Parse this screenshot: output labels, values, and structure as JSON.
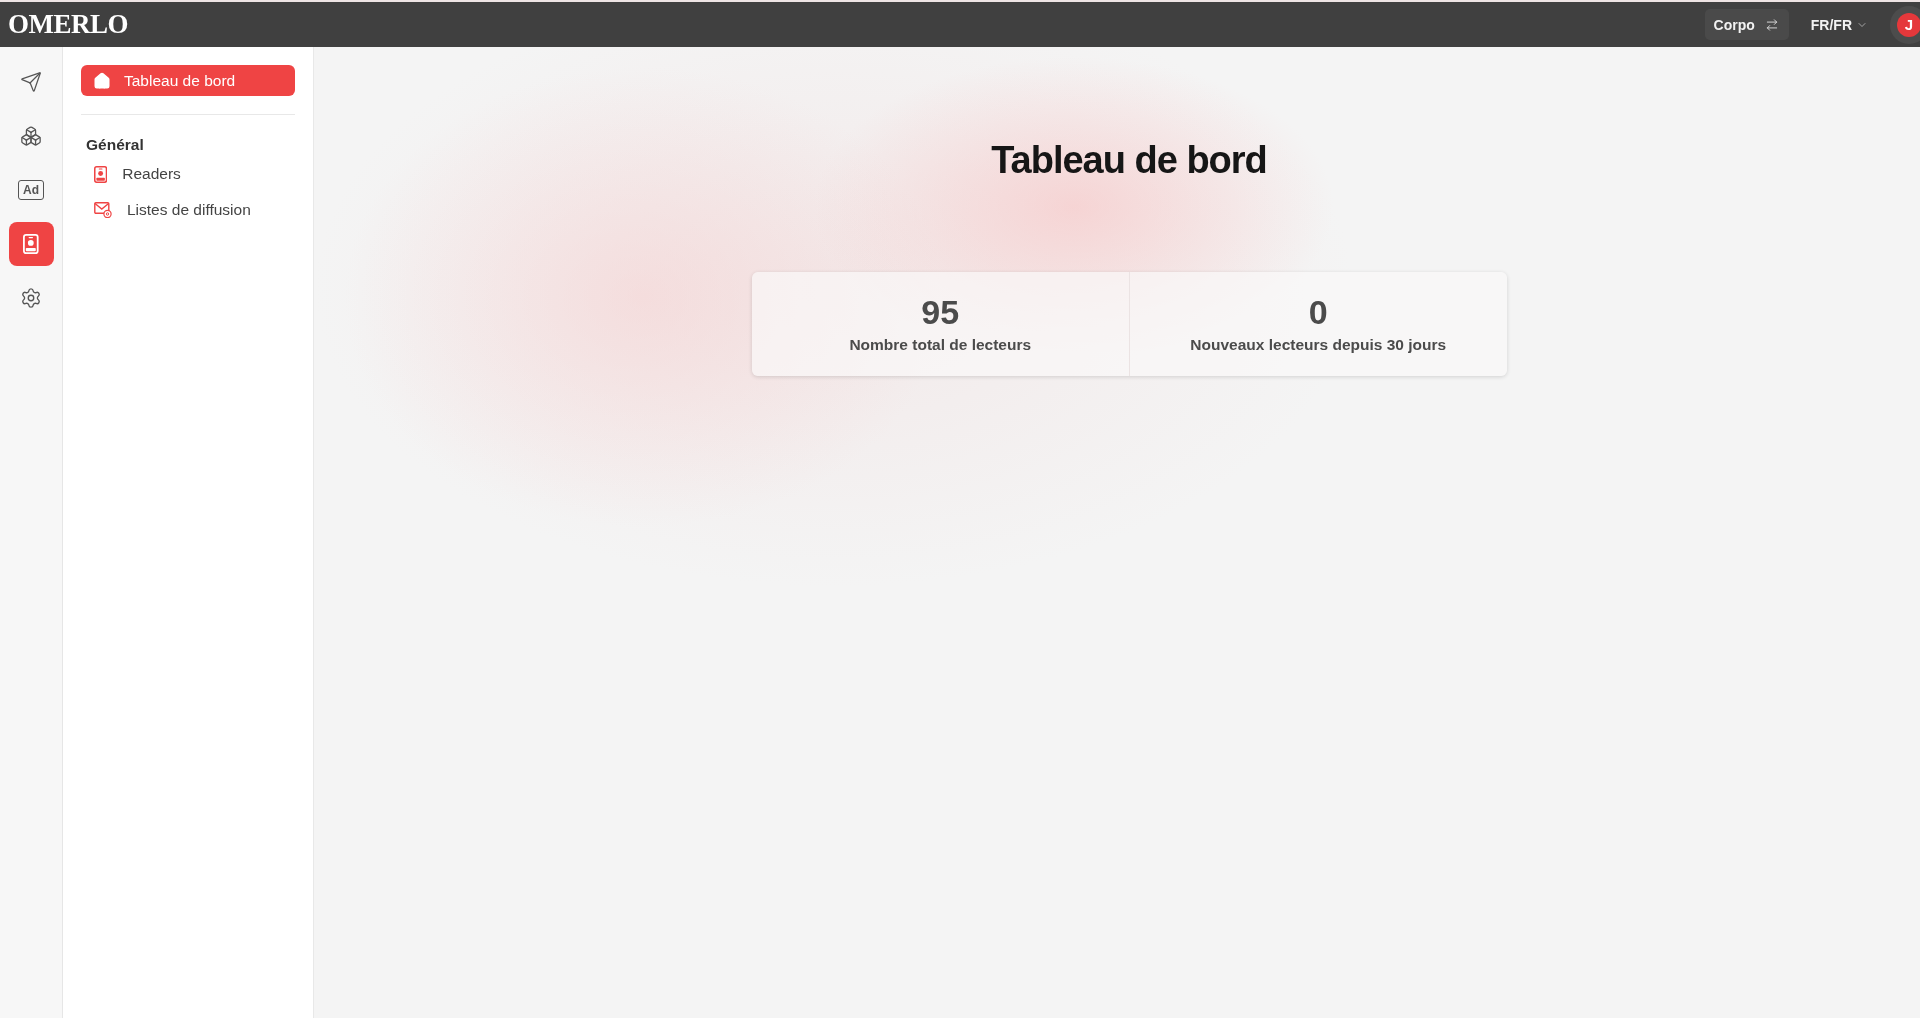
{
  "topbar": {
    "logo": "OMERLO",
    "workspace_button": {
      "label": "Corpo"
    },
    "language_menu": {
      "label": "FR/FR"
    },
    "avatar": {
      "initial": "J"
    }
  },
  "icon_rail": [
    {
      "kind": "send",
      "selected": false
    },
    {
      "kind": "cubes",
      "selected": false
    },
    {
      "kind": "ad",
      "label": "Ad",
      "selected": false
    },
    {
      "kind": "badge",
      "selected": true
    },
    {
      "kind": "gear",
      "selected": false
    }
  ],
  "sidebar": {
    "items": [
      {
        "kind": "home",
        "label": "Tableau de bord",
        "selected": true
      }
    ],
    "sections": [
      {
        "title": "Général",
        "items": [
          {
            "kind": "badge",
            "label": "Readers",
            "selected": false
          },
          {
            "kind": "mail",
            "label": "Listes de diffusion",
            "selected": false
          }
        ]
      }
    ]
  },
  "main": {
    "title": "Tableau de bord",
    "stats": [
      {
        "value": "95",
        "label": "Nombre total de lecteurs"
      },
      {
        "value": "0",
        "label": "Nouveaux lecteurs depuis 30 jours"
      }
    ]
  }
}
